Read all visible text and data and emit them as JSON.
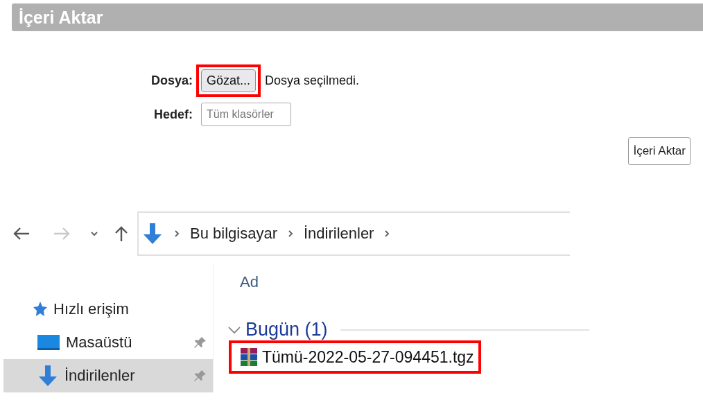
{
  "panel": {
    "title": "İçeri Aktar"
  },
  "form": {
    "fields": [
      {
        "kind": "file",
        "label": "Dosya:",
        "button": "Gözat...",
        "status": "Dosya seçilmedi.",
        "highlighted": true
      },
      {
        "kind": "text",
        "label": "Hedef:",
        "placeholder": "Tüm klasörler"
      }
    ],
    "submit": "İçeri Aktar"
  },
  "explorer": {
    "nav": {
      "back_disabled": false,
      "forward_disabled": true
    },
    "breadcrumb": [
      "Bu bilgisayar",
      "İndirilenler"
    ],
    "sidebar": {
      "items": [
        {
          "kind": "quick",
          "label": "Hızlı erişim",
          "pinned": false,
          "selected": false
        },
        {
          "kind": "desktop",
          "label": "Masaüstü",
          "pinned": true,
          "selected": false
        },
        {
          "kind": "downloads",
          "label": "İndirilenler",
          "pinned": true,
          "selected": true
        }
      ]
    },
    "column": "Ad",
    "groups": [
      {
        "label": "Bugün (1)",
        "expanded": true,
        "files": [
          {
            "name": "Tümü-2022-05-27-094451.tgz",
            "highlighted": true
          }
        ]
      }
    ]
  }
}
